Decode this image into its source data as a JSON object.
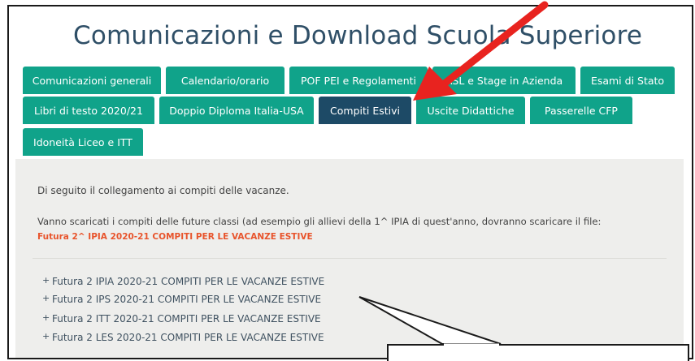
{
  "header": {
    "title": "Comunicazioni e Download Scuola Superiore"
  },
  "tabs": [
    {
      "label": "Comunicazioni generali",
      "active": false
    },
    {
      "label": "Calendario/orario",
      "active": false
    },
    {
      "label": "POF PEI e Regolamenti",
      "active": false
    },
    {
      "label": "ASL e Stage in Azienda",
      "active": false
    },
    {
      "label": "Esami di Stato",
      "active": false
    },
    {
      "label": "Libri di testo 2020/21",
      "active": false
    },
    {
      "label": "Doppio Diploma Italia-USA",
      "active": false
    },
    {
      "label": "Compiti Estivi",
      "active": true
    },
    {
      "label": "Uscite Didattiche",
      "active": false
    },
    {
      "label": "Passerelle CFP",
      "active": false
    },
    {
      "label": "Idoneità Liceo e ITT",
      "active": false
    }
  ],
  "content": {
    "intro": "Di seguito il collegamento ai compiti delle vacanze.",
    "instruction": "Vanno scaricati i compiti delle future classi (ad esempio gli allievi della 1^ IPIA di quest'anno, dovranno scaricare il file:",
    "example_file": "Futura 2^ IPIA 2020-21 COMPITI PER LE VACANZE ESTIVE",
    "downloads": [
      "Futura 2 IPIA 2020-21 COMPITI PER LE VACANZE ESTIVE",
      "Futura 2 IPS 2020-21 COMPITI PER LE VACANZE ESTIVE",
      "Futura 2 ITT 2020-21 COMPITI PER LE VACANZE ESTIVE",
      "Futura 2 LES 2020-21 COMPITI PER LE VACANZE ESTIVE"
    ]
  },
  "colors": {
    "tab": "#10a38a",
    "tab_active": "#1d4a66",
    "title": "#2f4f67",
    "highlight": "#e8542c",
    "annotation_arrow": "#e8231f"
  }
}
